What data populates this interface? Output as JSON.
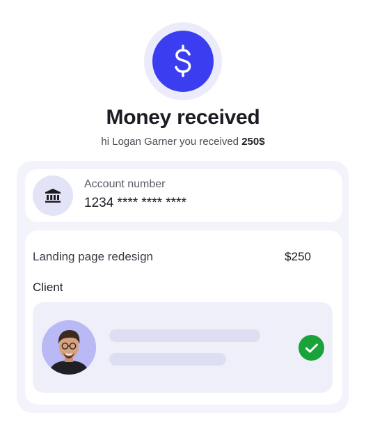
{
  "hero": {
    "icon": "dollar-icon",
    "accent_color": "#3a3df0",
    "ring_color": "#ebebfb"
  },
  "header": {
    "title": "Money received",
    "subtitle_prefix": "hi Logan Garner you received ",
    "subtitle_amount": "250$"
  },
  "account": {
    "icon": "bank-icon",
    "label": "Account number",
    "number": "1234 **** **** ****"
  },
  "project": {
    "name": "Landing page redesign",
    "amount": "$250",
    "client_label": "Client",
    "client": {
      "avatar": "client-avatar",
      "status_icon": "check-circle-icon",
      "status_color": "#1aa33a"
    }
  }
}
